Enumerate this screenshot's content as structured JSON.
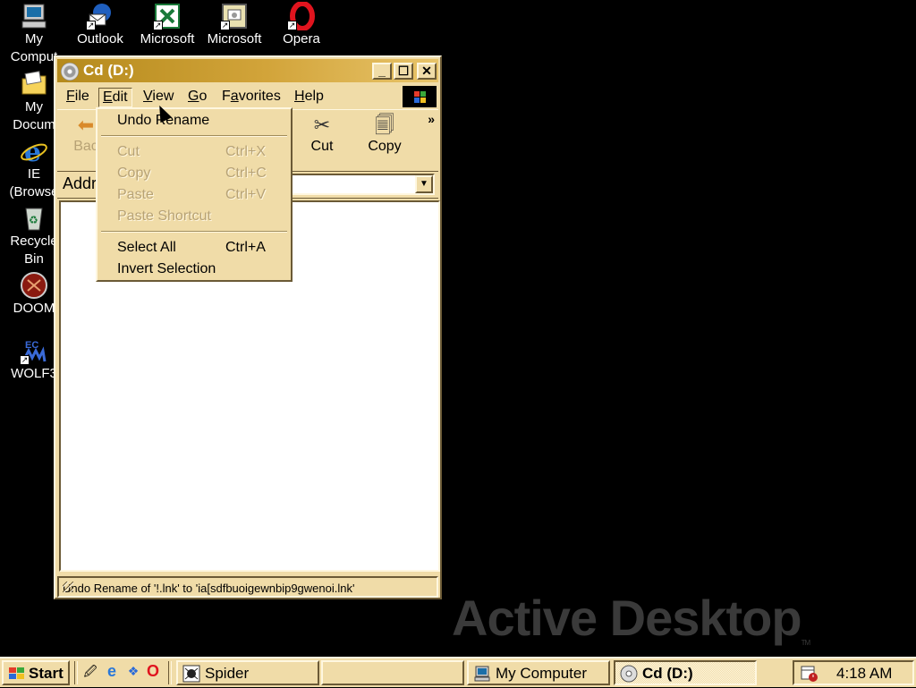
{
  "desktop": {
    "icons": [
      {
        "label": "My",
        "label2": "Comput",
        "icon": "my-computer-icon"
      },
      {
        "label": "Outlook",
        "icon": "outlook-icon"
      },
      {
        "label": "Microsoft",
        "icon": "excel-icon"
      },
      {
        "label": "Microsoft",
        "icon": "powerpoint-icon"
      },
      {
        "label": "Opera",
        "icon": "opera-icon"
      },
      {
        "label": "My",
        "label2": "Docum",
        "icon": "my-documents-icon"
      },
      {
        "label": "IE",
        "label2": "(Browse",
        "icon": "ie-icon"
      },
      {
        "label": "Recycle",
        "label2": "Bin",
        "icon": "recycle-bin-icon"
      },
      {
        "label": "DOOM",
        "icon": "doom-icon"
      },
      {
        "label": "WOLF3",
        "icon": "wolf3d-icon"
      }
    ],
    "watermark": "Active Desktop",
    "watermark_tm": "TM"
  },
  "window": {
    "title": "Cd (D:)",
    "minimize": "_",
    "maximize": "☐",
    "close": "✕",
    "menu": [
      {
        "label": "File",
        "u": "F"
      },
      {
        "label": "Edit",
        "u": "E"
      },
      {
        "label": "View",
        "u": "V"
      },
      {
        "label": "Go",
        "u": "G"
      },
      {
        "label": "Favorites",
        "u": "a"
      },
      {
        "label": "Help",
        "u": "H"
      }
    ],
    "toolbar": {
      "back": "Bac",
      "cut": "Cut",
      "copy": "Copy",
      "more": "»"
    },
    "address_label": "Addr",
    "status": "Undo Rename of '!.lnk' to 'ia[sdfbuoigewnbip9gwenoi.lnk'"
  },
  "edit_menu": {
    "items": [
      {
        "label": "Undo Rename",
        "shortcut": "",
        "enabled": true
      },
      {
        "label": "Cut",
        "shortcut": "Ctrl+X",
        "enabled": false
      },
      {
        "label": "Copy",
        "shortcut": "Ctrl+C",
        "enabled": false
      },
      {
        "label": "Paste",
        "shortcut": "Ctrl+V",
        "enabled": false
      },
      {
        "label": "Paste Shortcut",
        "shortcut": "",
        "enabled": false
      },
      {
        "label": "Select All",
        "shortcut": "Ctrl+A",
        "enabled": true
      },
      {
        "label": "Invert Selection",
        "shortcut": "",
        "enabled": true
      }
    ]
  },
  "taskbar": {
    "start": "Start",
    "tasks": [
      {
        "label": "Spider",
        "icon": "spider-icon"
      },
      {
        "label": "",
        "icon": ""
      },
      {
        "label": "My Computer",
        "icon": "my-computer-icon"
      },
      {
        "label": "Cd (D:)",
        "icon": "cd-drive-icon"
      }
    ],
    "clock": "4:18 AM"
  },
  "colors": {
    "face": "#f0dca8",
    "title_start": "#b58a1c",
    "title_end": "#e8c46a",
    "desktop": "#000000",
    "disabled_text": "#b7a275"
  }
}
